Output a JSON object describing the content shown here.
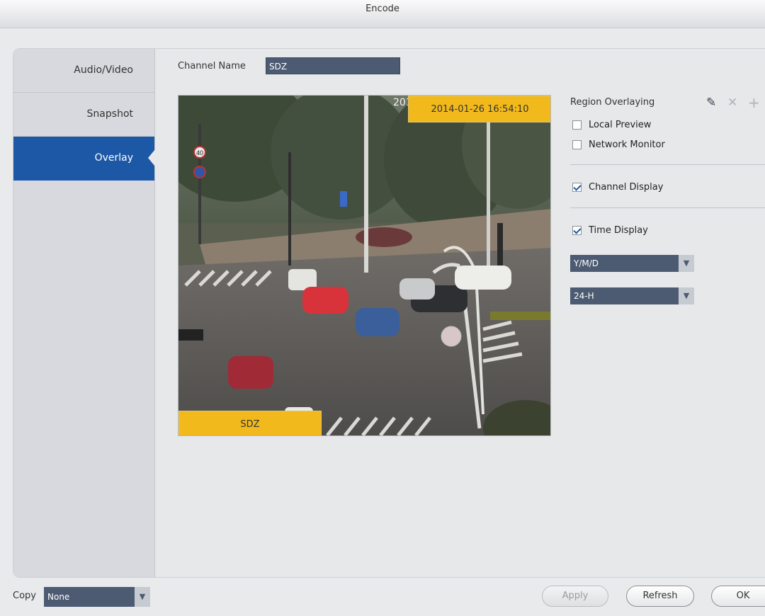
{
  "window": {
    "title": "Encode"
  },
  "sidebar": {
    "items": [
      {
        "label": "Audio/Video",
        "active": false
      },
      {
        "label": "Snapshot",
        "active": false
      },
      {
        "label": "Overlay",
        "active": true
      }
    ]
  },
  "channel": {
    "label": "Channel Name",
    "value": "SDZ"
  },
  "preview": {
    "time_overlay": "2014-01-26 16:54:10",
    "time_overlay_partial": "201",
    "channel_overlay": "SDZ",
    "speed_sign": "40"
  },
  "region": {
    "title": "Region Overlaying",
    "local_preview": {
      "label": "Local Preview",
      "checked": false
    },
    "network_monitor": {
      "label": "Network Monitor",
      "checked": false
    },
    "tools": [
      "pencil-icon",
      "delete-icon",
      "add-icon"
    ]
  },
  "channel_display": {
    "label": "Channel Display",
    "checked": true
  },
  "time_display": {
    "label": "Time Display",
    "checked": true,
    "date_format": "Y/M/D",
    "hour_format": "24-H"
  },
  "footer": {
    "copy_label": "Copy",
    "copy_value": "None",
    "apply": "Apply",
    "refresh": "Refresh",
    "ok": "OK"
  },
  "colors": {
    "accent": "#1d58a6",
    "overlay_yellow": "#f2b91c",
    "field_bg": "#4c5b72"
  }
}
